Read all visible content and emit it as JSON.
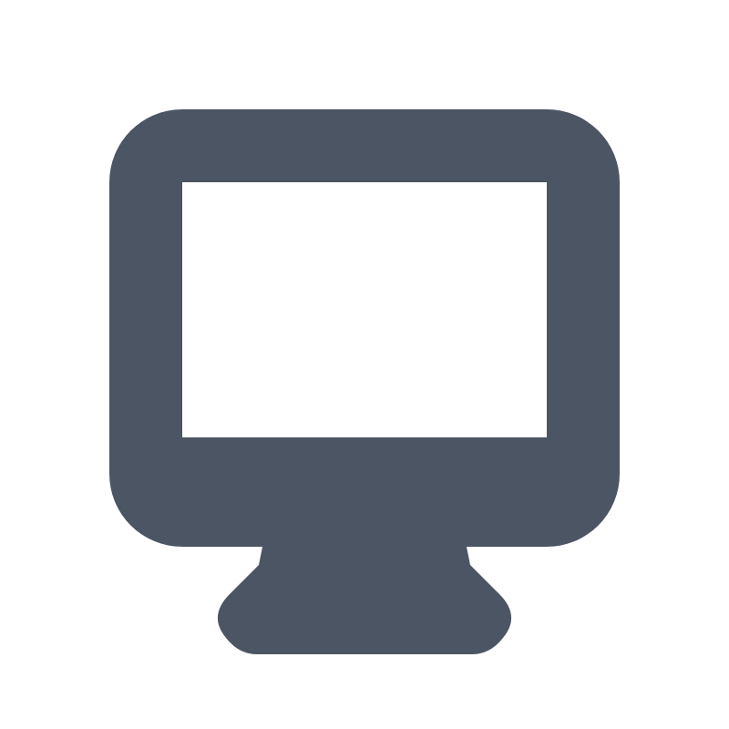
{
  "icon": {
    "name": "desktop-monitor-icon",
    "color": "#4b5563",
    "screen_color": "#ffffff"
  },
  "background": "#ffffff"
}
